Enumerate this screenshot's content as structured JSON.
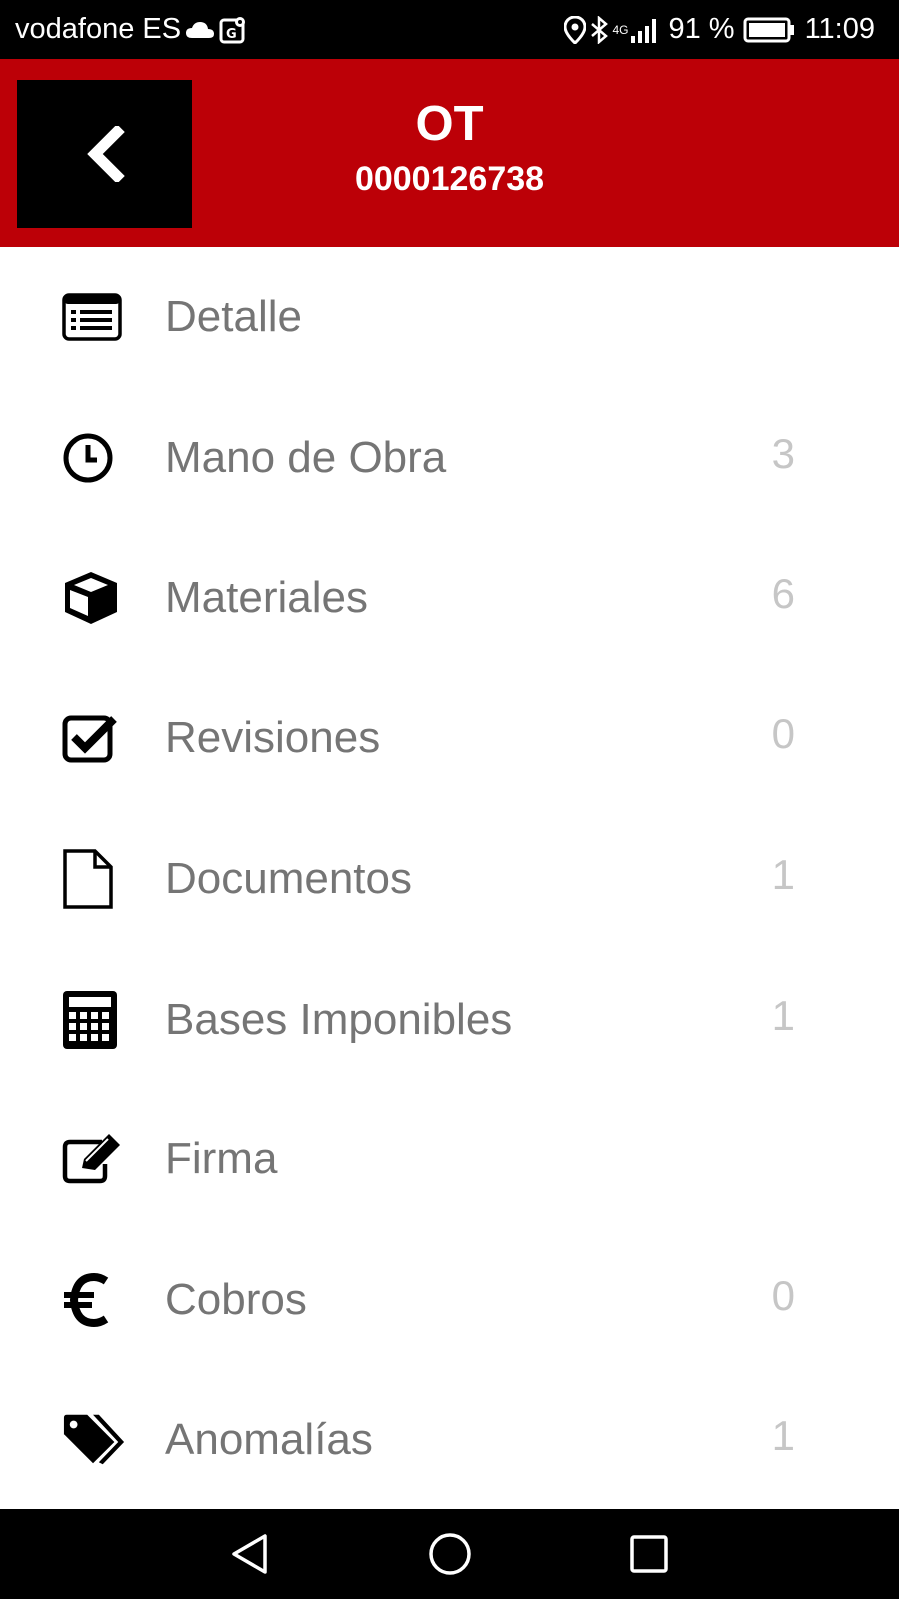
{
  "status_bar": {
    "carrier": "vodafone ES",
    "network": "4G",
    "battery_percent": "91 %",
    "time": "11:09",
    "icons": [
      "cloud-icon",
      "map-icon",
      "location-icon",
      "bluetooth-icon",
      "signal-icon",
      "battery-icon"
    ]
  },
  "header": {
    "title": "OT",
    "subtitle": "0000126738",
    "back_icon": "chevron-left-icon",
    "accent_color": "#bc0007"
  },
  "menu": {
    "items": [
      {
        "label": "Detalle",
        "count": "",
        "icon": "list-card-icon"
      },
      {
        "label": "Mano de Obra",
        "count": "3",
        "icon": "clock-icon"
      },
      {
        "label": "Materiales",
        "count": "6",
        "icon": "cube-icon"
      },
      {
        "label": "Revisiones",
        "count": "0",
        "icon": "checkbox-icon"
      },
      {
        "label": "Documentos",
        "count": "1",
        "icon": "document-icon"
      },
      {
        "label": "Bases Imponibles",
        "count": "1",
        "icon": "calculator-icon"
      },
      {
        "label": "Firma",
        "count": "",
        "icon": "edit-icon"
      },
      {
        "label": "Cobros",
        "count": "0",
        "icon": "euro-icon"
      },
      {
        "label": "Anomalías",
        "count": "1",
        "icon": "tags-icon"
      }
    ]
  },
  "nav_bar": {
    "buttons": [
      "back-nav-icon",
      "home-nav-icon",
      "recents-nav-icon"
    ]
  }
}
